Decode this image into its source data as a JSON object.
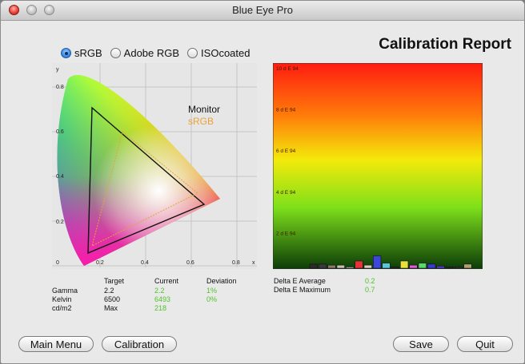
{
  "window": {
    "title": "Blue Eye Pro"
  },
  "report_title": "Calibration Report",
  "color_spaces": [
    {
      "label": "sRGB",
      "selected": true
    },
    {
      "label": "Adobe RGB",
      "selected": false
    },
    {
      "label": "ISOcoated",
      "selected": false
    }
  ],
  "cie_chart": {
    "y_axis_label": "y",
    "y_ticks": [
      "0.8",
      "0.6",
      "0.4",
      "0.2",
      "0"
    ],
    "x_ticks": [
      "0.2",
      "0.4",
      "0.6",
      "0.8"
    ],
    "x_axis_label": "x",
    "legend": {
      "monitor": "Monitor",
      "srgb": "sRGB"
    },
    "colors": {
      "monitor": "#111111",
      "srgb": "#e8a23a"
    }
  },
  "stats": {
    "headers": {
      "target": "Target",
      "current": "Current",
      "deviation": "Deviation"
    },
    "rows": [
      {
        "label": "Gamma",
        "target": "2.2",
        "current": "2.2",
        "deviation": "1%"
      },
      {
        "label": "Kelvin",
        "target": "6500",
        "current": "6493",
        "deviation": "0%"
      },
      {
        "label": "cd/m2",
        "target": "Max",
        "current": "218",
        "deviation": ""
      }
    ]
  },
  "delta": {
    "average_label": "Delta E Average",
    "average_value": "0.2",
    "maximum_label": "Delta E Maximum",
    "maximum_value": "0.7"
  },
  "chart_data": {
    "type": "bar",
    "ylim": [
      0,
      10
    ],
    "y_ticks": [
      "10 d E 94",
      "8 d E 94",
      "6 d E 94",
      "4 d E 94",
      "2 d E 94"
    ],
    "y_tick_values": [
      10,
      8,
      6,
      4,
      2
    ],
    "values": [
      0.2,
      0.2,
      0.15,
      0.15,
      0.05,
      0.35,
      0.15,
      0.6,
      0.25,
      0.05,
      0.35,
      0.15,
      0.25,
      0.2,
      0.1,
      0.05,
      0.05,
      0.2
    ],
    "bar_colors": [
      "#2a2a2a",
      "#3a3a3a",
      "#8a7a66",
      "#c9c0b3",
      "#d8d0c8",
      "#e8323a",
      "#d8d0c0",
      "#3b47d8",
      "#58c8d8",
      "#2a2a2a",
      "#e8e03a",
      "#e05ad8",
      "#5ad86a",
      "#3a3ad8",
      "#5a3ad8",
      "#2a2a2a",
      "#3a3a3a",
      "#b0a070"
    ],
    "grid": false
  },
  "buttons": {
    "main_menu": "Main Menu",
    "calibration": "Calibration",
    "save": "Save",
    "quit": "Quit"
  }
}
